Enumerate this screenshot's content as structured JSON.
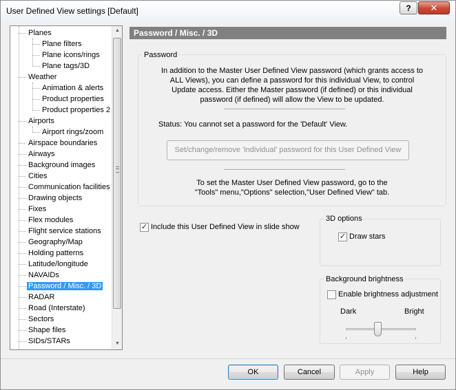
{
  "window": {
    "title": "User Defined View settings  [Default]",
    "help_glyph": "?",
    "close_glyph": "✕"
  },
  "tree": {
    "items": [
      {
        "label": "Planes",
        "level": 1
      },
      {
        "label": "Plane filters",
        "level": 2
      },
      {
        "label": "Plane icons/rings",
        "level": 2
      },
      {
        "label": "Plane tags/3D",
        "level": 2
      },
      {
        "label": "Weather",
        "level": 1
      },
      {
        "label": "Animation & alerts",
        "level": 2
      },
      {
        "label": "Product properties",
        "level": 2
      },
      {
        "label": "Product properties 2",
        "level": 2
      },
      {
        "label": "Airports",
        "level": 1
      },
      {
        "label": "Airport rings/zoom",
        "level": 2
      },
      {
        "label": "Airspace boundaries",
        "level": 1
      },
      {
        "label": "Airways",
        "level": 1
      },
      {
        "label": "Background images",
        "level": 1
      },
      {
        "label": "Cities",
        "level": 1
      },
      {
        "label": "Communication facilities",
        "level": 1
      },
      {
        "label": "Drawing objects",
        "level": 1
      },
      {
        "label": "Fixes",
        "level": 1
      },
      {
        "label": "Flex modules",
        "level": 1
      },
      {
        "label": "Flight service stations",
        "level": 1
      },
      {
        "label": "Geography/Map",
        "level": 1
      },
      {
        "label": "Holding patterns",
        "level": 1
      },
      {
        "label": "Latitude/longitude",
        "level": 1
      },
      {
        "label": "NAVAIDs",
        "level": 1
      },
      {
        "label": "Password / Misc. / 3D",
        "level": 1,
        "selected": true
      },
      {
        "label": "RADAR",
        "level": 1
      },
      {
        "label": "Road (Interstate)",
        "level": 1
      },
      {
        "label": "Sectors",
        "level": 1
      },
      {
        "label": "Shape files",
        "level": 1
      },
      {
        "label": "SIDs/STARs",
        "level": 1
      }
    ],
    "scroll_up": "▲",
    "scroll_down": "▼"
  },
  "panel": {
    "header": "Password / Misc. / 3D",
    "password_group": {
      "label": "Password",
      "intro_lines": [
        "In addition to the Master User Defined View password (which grants access to",
        "ALL Views), you can define a password for this individual View, to control",
        "Update access.  Either the Master password (if defined) or this individual",
        "password (if defined) will allow the View to be updated."
      ],
      "status": "Status:  You cannot set a password for the 'Default' View.",
      "set_button": "Set/change/remove 'individual' password for this User Defined View",
      "master_lines": [
        "To set the Master User Defined View password, go to the",
        "\"Tools\" menu,\"Options\" selection,\"User Defined View\" tab."
      ]
    },
    "slideshow": {
      "label": "Include this User Defined View in slide show",
      "checked": true
    },
    "options_3d": {
      "label": "3D options",
      "draw_stars": {
        "label": "Draw stars",
        "checked": true
      }
    },
    "brightness": {
      "label": "Background brightness",
      "enable": {
        "label": "Enable brightness adjustment",
        "checked": false
      },
      "dark_label": "Dark",
      "bright_label": "Bright",
      "level": 0.45
    }
  },
  "footer": {
    "ok": "OK",
    "cancel": "Cancel",
    "apply": "Apply",
    "help": "Help"
  },
  "check_glyph": "✓"
}
